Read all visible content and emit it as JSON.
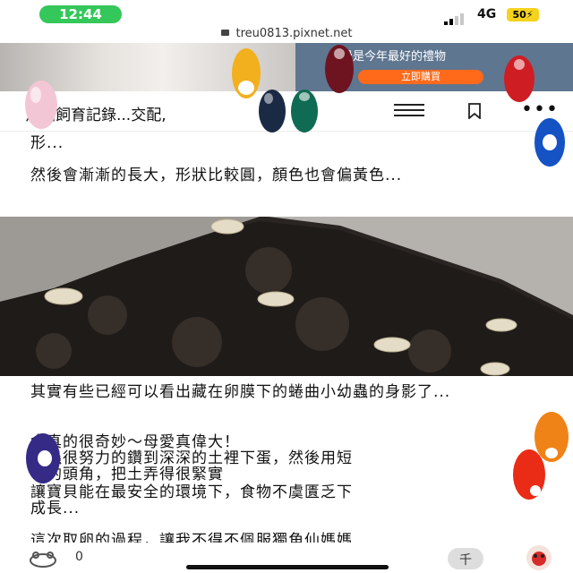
{
  "status_bar": {
    "time": "12:44",
    "network": "4G",
    "battery": "50"
  },
  "browser": {
    "url": "treu0813.pixnet.net"
  },
  "ad": {
    "headline": "睡覺是今年最好的禮物",
    "button": "立即購買"
  },
  "header": {
    "title": "角仙飼育記錄...交配,",
    "menu_icon": "menu-icon",
    "bookmark_icon": "bookmark-icon",
    "more_icon": "more-icon"
  },
  "article": {
    "p1": "形...",
    "p2": "然後會漸漸的長大，形狀比較圓，顏色也會偏黃色...",
    "p3": "其實有些已經可以看出藏在卵膜下的蜷曲小幼蟲的身影了...",
    "p4_l1": "命真的很奇妙～母愛真偉大！",
    "p4_l2": "蟲很努力的鑽到深深的土裡下蛋，然後用短",
    "p4_l3": "的頭角，把土弄得很緊實",
    "p4_l4": "讓寶貝能在最安全的環境下，食物不虞匱乏下",
    "p4_l5": "成長...",
    "p5": "這次取卵的過程，讓我不得不佩服獨角仙媽媽"
  },
  "bottom_bar": {
    "like_count": "0"
  },
  "colors": {
    "accent_green": "#34c759",
    "battery": "#f5d21e",
    "ad_button": "#ff6a1a"
  }
}
